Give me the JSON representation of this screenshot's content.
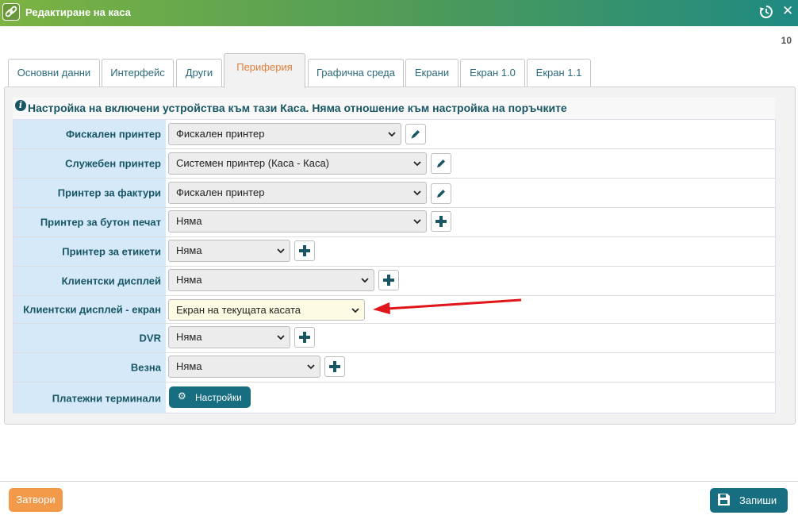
{
  "window": {
    "title": "Редактиране на каса",
    "record_number": "10"
  },
  "tabs": [
    {
      "label": "Основни данни"
    },
    {
      "label": "Интерфейс"
    },
    {
      "label": "Други"
    },
    {
      "label": "Периферия",
      "active": true
    },
    {
      "label": "Графична среда"
    },
    {
      "label": "Екрани"
    },
    {
      "label": "Екран 1.0"
    },
    {
      "label": "Екран 1.1"
    }
  ],
  "info": {
    "text": "Настройка на включени устройства към тази Каса. Няма отношение към настройка на поръчките",
    "icon": "info-icon"
  },
  "rows": [
    {
      "label": "Фискален принтер",
      "value": "Фискален принтер",
      "action": "edit"
    },
    {
      "label": "Служебен принтер",
      "value": "Системен принтер (Каса - Каса)",
      "action": "edit"
    },
    {
      "label": "Принтер за фактури",
      "value": "Фискален принтер",
      "action": "edit"
    },
    {
      "label": "Принтер за бутон печат",
      "value": "Няма",
      "action": "add"
    },
    {
      "label": "Принтер за етикети",
      "value": "Няма",
      "action": "add"
    },
    {
      "label": "Клиентски дисплей",
      "value": "Няма",
      "action": "add"
    },
    {
      "label": "Клиентски дисплей - екран",
      "value": "Екран на текущата касата",
      "action": "none",
      "highlighted": true
    },
    {
      "label": "DVR",
      "value": "Няма",
      "action": "add"
    },
    {
      "label": "Везна",
      "value": "Няма",
      "action": "add"
    },
    {
      "label": "Платежни терминали",
      "button": "Настройки"
    }
  ],
  "footer": {
    "close_label": "Затвори",
    "save_label": "Запиши"
  },
  "colors": {
    "accent": "#176e80",
    "label_bg": "#d5e9f9",
    "label_text": "#185664",
    "close_btn": "#f2994a",
    "active_tab": "#e0803a",
    "annotation_arrow": "#e0161b"
  }
}
